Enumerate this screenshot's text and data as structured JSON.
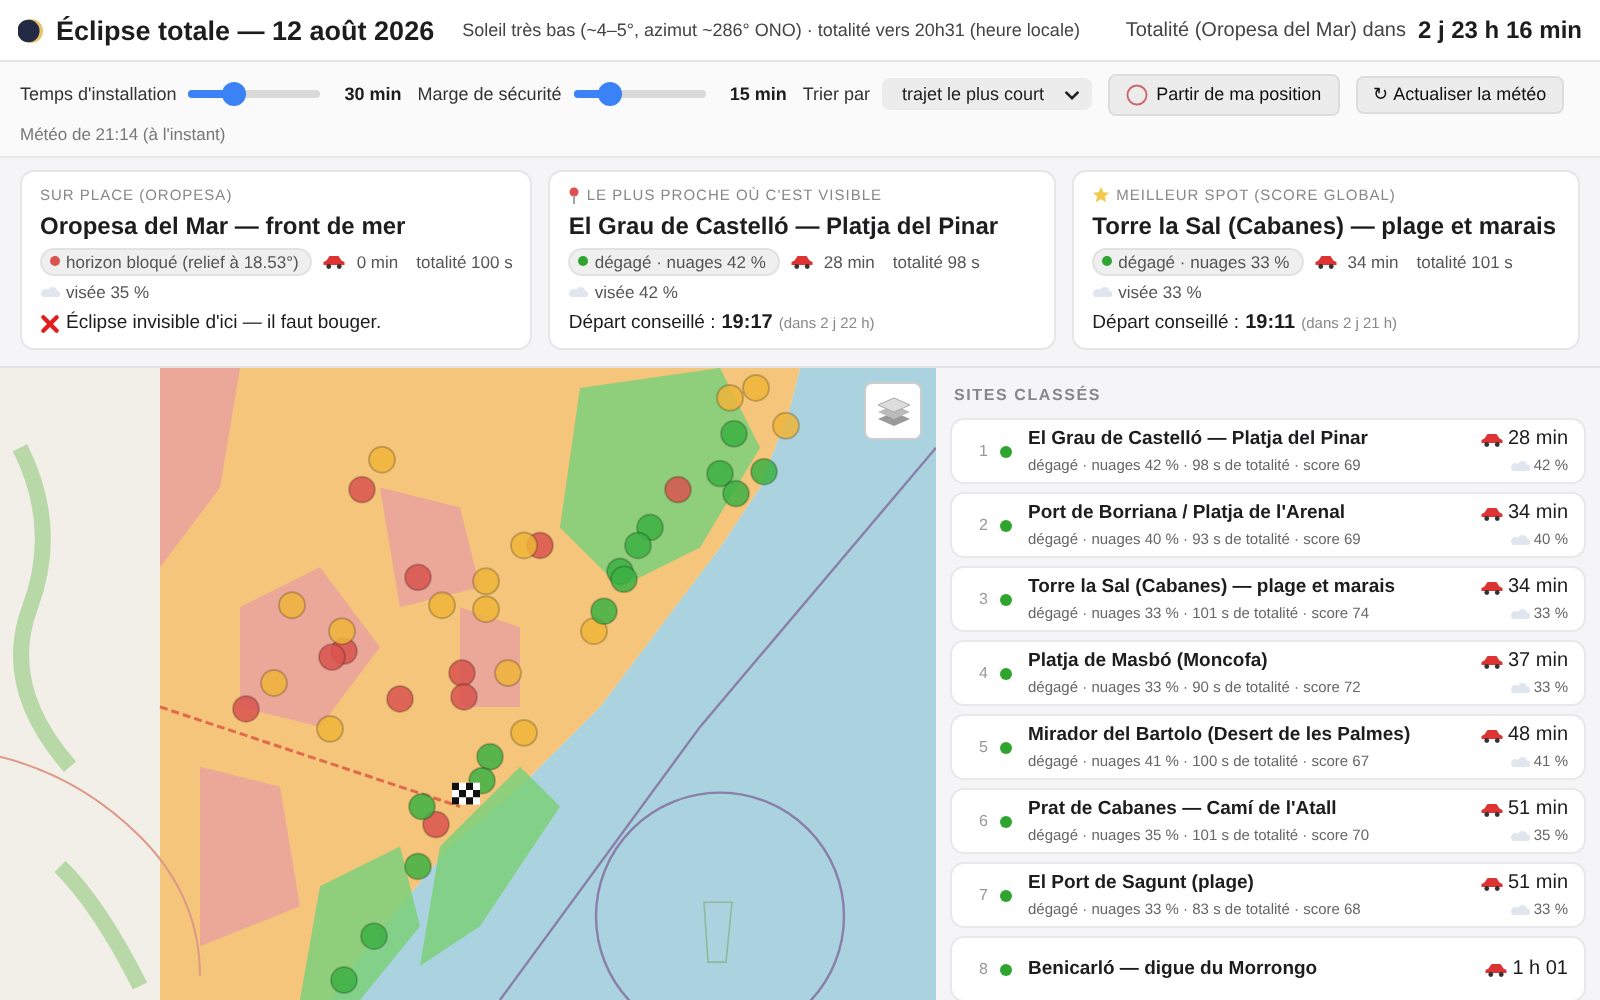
{
  "header": {
    "title": "Éclipse totale — 12 août 2026",
    "subtitle": "Soleil très bas (~4–5°, azimut ~286° ONO) · totalité vers 20h31 (heure locale)",
    "countdown_prefix": "Totalité (Oropesa del Mar) dans",
    "countdown": "2 j 23 h 16 min"
  },
  "controls": {
    "sliders": [
      {
        "label": "Temps d'installation",
        "level": 0.35,
        "value": "30 min"
      },
      {
        "label": "Marge de sécurité",
        "level": 0.27,
        "value": "15 min"
      }
    ],
    "sort": {
      "label": "Trier par",
      "value": "trajet le plus court"
    },
    "buttons": [
      {
        "kind": "locate",
        "label": "Partir de ma position"
      },
      {
        "kind": "refresh",
        "label": "↻ Actualiser la météo"
      }
    ],
    "meteo_note": "Météo de 21:14 (à l'instant)"
  },
  "cards": [
    {
      "kind": "here",
      "eyebrow": "SUR PLACE (OROPESA)",
      "title": "Oropesa del Mar — front de mer",
      "status": {
        "color": "#d9534f",
        "text": "horizon bloqué (relief à 18.53°)"
      },
      "drive": "0 min",
      "totality": "totalité 100 s",
      "aim": "visée 35 %",
      "footer": {
        "kind": "warning",
        "text": "Éclipse invisible d'ici — il faut bouger."
      }
    },
    {
      "kind": "nearest",
      "eyebrow": "LE PLUS PROCHE OÙ C'EST VISIBLE",
      "title": "El Grau de Castelló — Platja del Pinar",
      "status": {
        "color": "#2fa52f",
        "text": "dégagé · nuages 42 %"
      },
      "drive": "28 min",
      "totality": "totalité 98 s",
      "aim": "visée 42 %",
      "footer": {
        "kind": "departure",
        "label": "Départ conseillé :",
        "time": "19:17",
        "relative": "(dans 2 j 22 h)"
      }
    },
    {
      "kind": "best",
      "eyebrow": "MEILLEUR SPOT (SCORE GLOBAL)",
      "title": "Torre la Sal (Cabanes) — plage et marais",
      "status": {
        "color": "#2fa52f",
        "text": "dégagé · nuages 33 %"
      },
      "drive": "34 min",
      "totality": "totalité 101 s",
      "aim": "visée 33 %",
      "footer": {
        "kind": "departure",
        "label": "Départ conseillé :",
        "time": "19:11",
        "relative": "(dans 2 j 21 h)"
      }
    }
  ],
  "ranking": {
    "heading": "SITES CLASSÉS",
    "items": [
      {
        "rank": "1",
        "color": "#2fa52f",
        "name": "El Grau de Castelló — Platja del Pinar",
        "detail": "dégagé · nuages 42 % · 98 s de totalité · score 69",
        "drive": "28 min",
        "clouds": "42 %"
      },
      {
        "rank": "2",
        "color": "#2fa52f",
        "name": "Port de Borriana / Platja de l'Arenal",
        "detail": "dégagé · nuages 40 % · 93 s de totalité · score 69",
        "drive": "34 min",
        "clouds": "40 %"
      },
      {
        "rank": "3",
        "color": "#2fa52f",
        "name": "Torre la Sal (Cabanes) — plage et marais",
        "detail": "dégagé · nuages 33 % · 101 s de totalité · score 74",
        "drive": "34 min",
        "clouds": "33 %"
      },
      {
        "rank": "4",
        "color": "#2fa52f",
        "name": "Platja de Masbó (Moncofa)",
        "detail": "dégagé · nuages 33 % · 90 s de totalité · score 72",
        "drive": "37 min",
        "clouds": "33 %"
      },
      {
        "rank": "5",
        "color": "#2fa52f",
        "name": "Mirador del Bartolo (Desert de les Palmes)",
        "detail": "dégagé · nuages 41 % · 100 s de totalité · score 67",
        "drive": "48 min",
        "clouds": "41 %"
      },
      {
        "rank": "6",
        "color": "#2fa52f",
        "name": "Prat de Cabanes — Camí de l'Atall",
        "detail": "dégagé · nuages 35 % · 101 s de totalité · score 70",
        "drive": "51 min",
        "clouds": "35 %"
      },
      {
        "rank": "7",
        "color": "#2fa52f",
        "name": "El Port de Sagunt (plage)",
        "detail": "dégagé · nuages 33 % · 83 s de totalité · score 68",
        "drive": "51 min",
        "clouds": "33 %"
      },
      {
        "rank": "8",
        "color": "#2fa52f",
        "name": "Benicarló — digue du Morrongo",
        "drive": "1 h 01"
      }
    ]
  }
}
